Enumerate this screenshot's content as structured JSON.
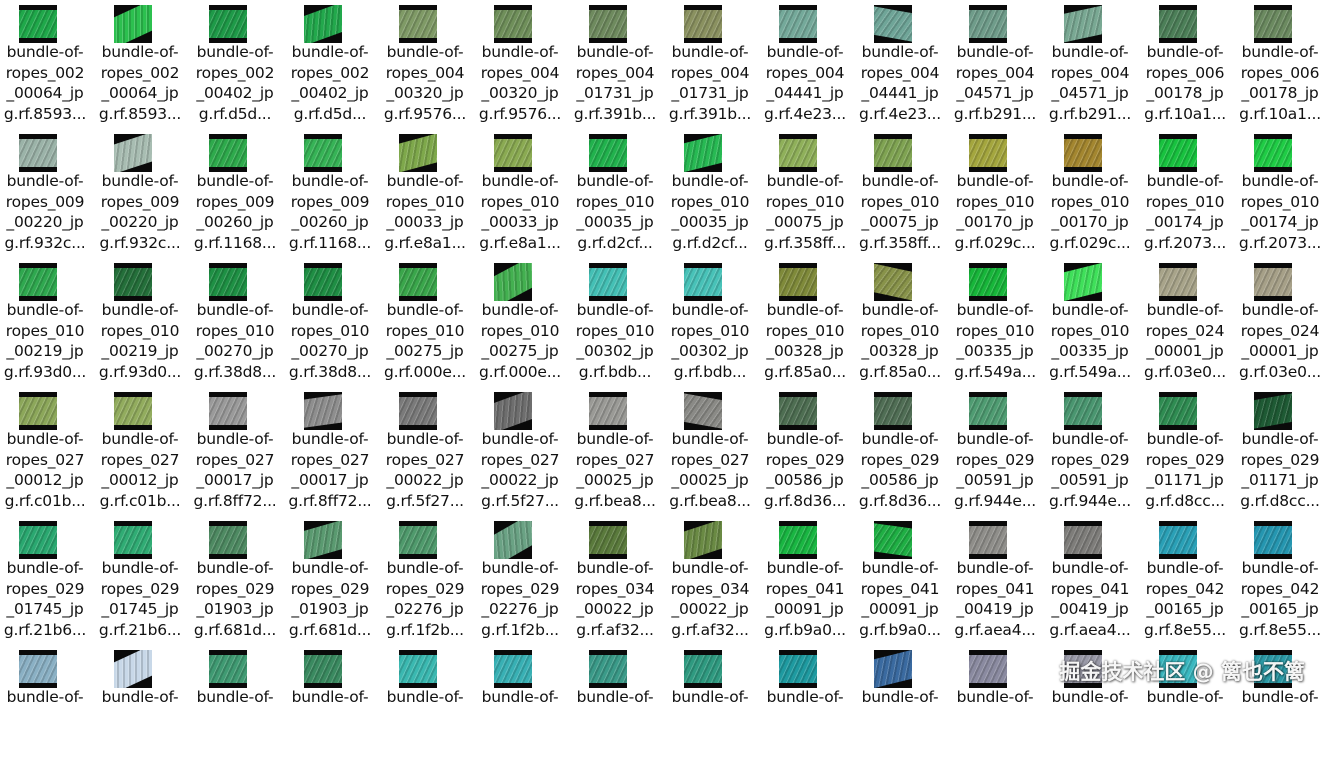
{
  "files": [
    {
      "line1": "bundle-of-",
      "line2": "ropes_002",
      "line3": "_00064_jp",
      "line4": "g.rf.8593...",
      "color": "#1fa84a",
      "tilt": 0
    },
    {
      "line1": "bundle-of-",
      "line2": "ropes_002",
      "line3": "_00064_jp",
      "line4": "g.rf.8593...",
      "color": "#2cc04f",
      "tilt": -25
    },
    {
      "line1": "bundle-of-",
      "line2": "ropes_002",
      "line3": "_00402_jp",
      "line4": "g.rf.d5d...",
      "color": "#1e9a48",
      "tilt": 0
    },
    {
      "line1": "bundle-of-",
      "line2": "ropes_002",
      "line3": "_00402_jp",
      "line4": "g.rf.d5d...",
      "color": "#22a84c",
      "tilt": -20
    },
    {
      "line1": "bundle-of-",
      "line2": "ropes_004",
      "line3": "_00320_jp",
      "line4": "g.rf.9576...",
      "color": "#7f9a66",
      "tilt": 0
    },
    {
      "line1": "bundle-of-",
      "line2": "ropes_004",
      "line3": "_00320_jp",
      "line4": "g.rf.9576...",
      "color": "#6f8f5a",
      "tilt": 0
    },
    {
      "line1": "bundle-of-",
      "line2": "ropes_004",
      "line3": "_01731_jp",
      "line4": "g.rf.391b...",
      "color": "#6e8a5e",
      "tilt": 0
    },
    {
      "line1": "bundle-of-",
      "line2": "ropes_004",
      "line3": "_01731_jp",
      "line4": "g.rf.391b...",
      "color": "#8a9160",
      "tilt": 0
    },
    {
      "line1": "bundle-of-",
      "line2": "ropes_004",
      "line3": "_04441_jp",
      "line4": "g.rf.4e23...",
      "color": "#74a99a",
      "tilt": 0
    },
    {
      "line1": "bundle-of-",
      "line2": "ropes_004",
      "line3": "_04441_jp",
      "line4": "g.rf.4e23...",
      "color": "#6fa598",
      "tilt": 10
    },
    {
      "line1": "bundle-of-",
      "line2": "ropes_004",
      "line3": "_04571_jp",
      "line4": "g.rf.b291...",
      "color": "#6f9c8a",
      "tilt": 0
    },
    {
      "line1": "bundle-of-",
      "line2": "ropes_004",
      "line3": "_04571_jp",
      "line4": "g.rf.b291...",
      "color": "#79a893",
      "tilt": -12
    },
    {
      "line1": "bundle-of-",
      "line2": "ropes_006",
      "line3": "_00178_jp",
      "line4": "g.rf.10a1...",
      "color": "#4c7f58",
      "tilt": 0
    },
    {
      "line1": "bundle-of-",
      "line2": "ropes_006",
      "line3": "_00178_jp",
      "line4": "g.rf.10a1...",
      "color": "#6b8a60",
      "tilt": 0
    },
    {
      "line1": "bundle-of-",
      "line2": "ropes_009",
      "line3": "_00220_jp",
      "line4": "g.rf.932c...",
      "color": "#9bb3a8",
      "tilt": 0
    },
    {
      "line1": "bundle-of-",
      "line2": "ropes_009",
      "line3": "_00220_jp",
      "line4": "g.rf.932c...",
      "color": "#a8bdb2",
      "tilt": -18
    },
    {
      "line1": "bundle-of-",
      "line2": "ropes_009",
      "line3": "_00260_jp",
      "line4": "g.rf.1168...",
      "color": "#2eaa4c",
      "tilt": 0
    },
    {
      "line1": "bundle-of-",
      "line2": "ropes_009",
      "line3": "_00260_jp",
      "line4": "g.rf.1168...",
      "color": "#36b356",
      "tilt": 0
    },
    {
      "line1": "bundle-of-",
      "line2": "ropes_010",
      "line3": "_00033_jp",
      "line4": "g.rf.e8a1...",
      "color": "#7ea84b",
      "tilt": -15
    },
    {
      "line1": "bundle-of-",
      "line2": "ropes_010",
      "line3": "_00033_jp",
      "line4": "g.rf.e8a1...",
      "color": "#8aaa52",
      "tilt": 0
    },
    {
      "line1": "bundle-of-",
      "line2": "ropes_010",
      "line3": "_00035_jp",
      "line4": "g.rf.d2cf...",
      "color": "#21b24d",
      "tilt": 0
    },
    {
      "line1": "bundle-of-",
      "line2": "ropes_010",
      "line3": "_00035_jp",
      "line4": "g.rf.d2cf...",
      "color": "#27b953",
      "tilt": -14
    },
    {
      "line1": "bundle-of-",
      "line2": "ropes_010",
      "line3": "_00075_jp",
      "line4": "g.rf.358ff...",
      "color": "#8fb05a",
      "tilt": 0
    },
    {
      "line1": "bundle-of-",
      "line2": "ropes_010",
      "line3": "_00075_jp",
      "line4": "g.rf.358ff...",
      "color": "#7fa352",
      "tilt": 0
    },
    {
      "line1": "bundle-of-",
      "line2": "ropes_010",
      "line3": "_00170_jp",
      "line4": "g.rf.029c...",
      "color": "#a4a63e",
      "tilt": 0
    },
    {
      "line1": "bundle-of-",
      "line2": "ropes_010",
      "line3": "_00170_jp",
      "line4": "g.rf.029c...",
      "color": "#a3862f",
      "tilt": 0
    },
    {
      "line1": "bundle-of-",
      "line2": "ropes_010",
      "line3": "_00174_jp",
      "line4": "g.rf.2073...",
      "color": "#18c23f",
      "tilt": 0
    },
    {
      "line1": "bundle-of-",
      "line2": "ropes_010",
      "line3": "_00174_jp",
      "line4": "g.rf.2073...",
      "color": "#1fcc45",
      "tilt": 0
    },
    {
      "line1": "bundle-of-",
      "line2": "ropes_010",
      "line3": "_00219_jp",
      "line4": "g.rf.93d0...",
      "color": "#2fa84f",
      "tilt": 0
    },
    {
      "line1": "bundle-of-",
      "line2": "ropes_010",
      "line3": "_00219_jp",
      "line4": "g.rf.93d0...",
      "color": "#246f3a",
      "tilt": 0
    },
    {
      "line1": "bundle-of-",
      "line2": "ropes_010",
      "line3": "_00270_jp",
      "line4": "g.rf.38d8...",
      "color": "#1e9044",
      "tilt": 0
    },
    {
      "line1": "bundle-of-",
      "line2": "ropes_010",
      "line3": "_00270_jp",
      "line4": "g.rf.38d8...",
      "color": "#1f8e44",
      "tilt": 0
    },
    {
      "line1": "bundle-of-",
      "line2": "ropes_010",
      "line3": "_00275_jp",
      "line4": "g.rf.000e...",
      "color": "#3aa64b",
      "tilt": 0
    },
    {
      "line1": "bundle-of-",
      "line2": "ropes_010",
      "line3": "_00275_jp",
      "line4": "g.rf.000e...",
      "color": "#43b050",
      "tilt": -28
    },
    {
      "line1": "bundle-of-",
      "line2": "ropes_010",
      "line3": "_00302_jp",
      "line4": "g.rf.bdb...",
      "color": "#44c0b5",
      "tilt": 0
    },
    {
      "line1": "bundle-of-",
      "line2": "ropes_010",
      "line3": "_00302_jp",
      "line4": "g.rf.bdb...",
      "color": "#48c2b8",
      "tilt": 0
    },
    {
      "line1": "bundle-of-",
      "line2": "ropes_010",
      "line3": "_00328_jp",
      "line4": "g.rf.85a0...",
      "color": "#7f8a3a",
      "tilt": 0
    },
    {
      "line1": "bundle-of-",
      "line2": "ropes_010",
      "line3": "_00328_jp",
      "line4": "g.rf.85a0...",
      "color": "#88934a",
      "tilt": 12
    },
    {
      "line1": "bundle-of-",
      "line2": "ropes_010",
      "line3": "_00335_jp",
      "line4": "g.rf.549a...",
      "color": "#17b63a",
      "tilt": 0
    },
    {
      "line1": "bundle-of-",
      "line2": "ropes_010",
      "line3": "_00335_jp",
      "line4": "g.rf.549a...",
      "color": "#3fe05a",
      "tilt": -14
    },
    {
      "line1": "bundle-of-",
      "line2": "ropes_024",
      "line3": "_00001_jp",
      "line4": "g.rf.03e0...",
      "color": "#a8a48a",
      "tilt": 0
    },
    {
      "line1": "bundle-of-",
      "line2": "ropes_024",
      "line3": "_00001_jp",
      "line4": "g.rf.03e0...",
      "color": "#a6a088",
      "tilt": 0
    },
    {
      "line1": "bundle-of-",
      "line2": "ropes_027",
      "line3": "_00012_jp",
      "line4": "g.rf.c01b...",
      "color": "#8ca75a",
      "tilt": 0
    },
    {
      "line1": "bundle-of-",
      "line2": "ropes_027",
      "line3": "_00012_jp",
      "line4": "g.rf.c01b...",
      "color": "#92ac5e",
      "tilt": 0
    },
    {
      "line1": "bundle-of-",
      "line2": "ropes_027",
      "line3": "_00017_jp",
      "line4": "g.rf.8ff72...",
      "color": "#9a9a9a",
      "tilt": 0
    },
    {
      "line1": "bundle-of-",
      "line2": "ropes_027",
      "line3": "_00017_jp",
      "line4": "g.rf.8ff72...",
      "color": "#8e8e8e",
      "tilt": -8
    },
    {
      "line1": "bundle-of-",
      "line2": "ropes_027",
      "line3": "_00022_jp",
      "line4": "g.rf.5f27...",
      "color": "#7a7a7a",
      "tilt": 0
    },
    {
      "line1": "bundle-of-",
      "line2": "ropes_027",
      "line3": "_00022_jp",
      "line4": "g.rf.5f27...",
      "color": "#6e6e6e",
      "tilt": -20
    },
    {
      "line1": "bundle-of-",
      "line2": "ropes_027",
      "line3": "_00025_jp",
      "line4": "g.rf.bea8...",
      "color": "#9a9a96",
      "tilt": 0
    },
    {
      "line1": "bundle-of-",
      "line2": "ropes_027",
      "line3": "_00025_jp",
      "line4": "g.rf.bea8...",
      "color": "#8a8a86",
      "tilt": 10
    },
    {
      "line1": "bundle-of-",
      "line2": "ropes_029",
      "line3": "_00586_jp",
      "line4": "g.rf.8d36...",
      "color": "#4e6e52",
      "tilt": 0
    },
    {
      "line1": "bundle-of-",
      "line2": "ropes_029",
      "line3": "_00586_jp",
      "line4": "g.rf.8d36...",
      "color": "#506e55",
      "tilt": 0
    },
    {
      "line1": "bundle-of-",
      "line2": "ropes_029",
      "line3": "_00591_jp",
      "line4": "g.rf.944e...",
      "color": "#4f9c72",
      "tilt": 0
    },
    {
      "line1": "bundle-of-",
      "line2": "ropes_029",
      "line3": "_00591_jp",
      "line4": "g.rf.944e...",
      "color": "#4a9670",
      "tilt": 0
    },
    {
      "line1": "bundle-of-",
      "line2": "ropes_029",
      "line3": "_01171_jp",
      "line4": "g.rf.d8cc...",
      "color": "#2f8c52",
      "tilt": 0
    },
    {
      "line1": "bundle-of-",
      "line2": "ropes_029",
      "line3": "_01171_jp",
      "line4": "g.rf.d8cc...",
      "color": "#1e5a34",
      "tilt": -10
    },
    {
      "line1": "bundle-of-",
      "line2": "ropes_029",
      "line3": "_01745_jp",
      "line4": "g.rf.21b6...",
      "color": "#2aa870",
      "tilt": 0
    },
    {
      "line1": "bundle-of-",
      "line2": "ropes_029",
      "line3": "_01745_jp",
      "line4": "g.rf.21b6...",
      "color": "#30ac74",
      "tilt": 0
    },
    {
      "line1": "bundle-of-",
      "line2": "ropes_029",
      "line3": "_01903_jp",
      "line4": "g.rf.681d...",
      "color": "#4e8a62",
      "tilt": 0
    },
    {
      "line1": "bundle-of-",
      "line2": "ropes_029",
      "line3": "_01903_jp",
      "line4": "g.rf.681d...",
      "color": "#5a9a70",
      "tilt": -16
    },
    {
      "line1": "bundle-of-",
      "line2": "ropes_029",
      "line3": "_02276_jp",
      "line4": "g.rf.1f2b...",
      "color": "#4f9a6c",
      "tilt": 0
    },
    {
      "line1": "bundle-of-",
      "line2": "ropes_029",
      "line3": "_02276_jp",
      "line4": "g.rf.1f2b...",
      "color": "#6aa284",
      "tilt": -30
    },
    {
      "line1": "bundle-of-",
      "line2": "ropes_034",
      "line3": "_00022_jp",
      "line4": "g.rf.af32...",
      "color": "#5a7a3c",
      "tilt": 0
    },
    {
      "line1": "bundle-of-",
      "line2": "ropes_034",
      "line3": "_00022_jp",
      "line4": "g.rf.af32...",
      "color": "#6a8a44",
      "tilt": -18
    },
    {
      "line1": "bundle-of-",
      "line2": "ropes_041",
      "line3": "_00091_jp",
      "line4": "g.rf.b9a0...",
      "color": "#19b642",
      "tilt": 0
    },
    {
      "line1": "bundle-of-",
      "line2": "ropes_041",
      "line3": "_00091_jp",
      "line4": "g.rf.b9a0...",
      "color": "#1faf44",
      "tilt": 8
    },
    {
      "line1": "bundle-of-",
      "line2": "ropes_041",
      "line3": "_00419_jp",
      "line4": "g.rf.aea4...",
      "color": "#8f8e8a",
      "tilt": 0
    },
    {
      "line1": "bundle-of-",
      "line2": "ropes_041",
      "line3": "_00419_jp",
      "line4": "g.rf.aea4...",
      "color": "#7e7d7a",
      "tilt": 0
    },
    {
      "line1": "bundle-of-",
      "line2": "ropes_042",
      "line3": "_00165_jp",
      "line4": "g.rf.8e55...",
      "color": "#2aa0b6",
      "tilt": 0
    },
    {
      "line1": "bundle-of-",
      "line2": "ropes_042",
      "line3": "_00165_jp",
      "line4": "g.rf.8e55...",
      "color": "#2596b0",
      "tilt": 0
    },
    {
      "line1": "bundle-of-",
      "line2": "",
      "line3": "",
      "line4": "",
      "color": "#8ab0c4",
      "tilt": 0
    },
    {
      "line1": "bundle-of-",
      "line2": "",
      "line3": "",
      "line4": "",
      "color": "#c8d8e8",
      "tilt": -25
    },
    {
      "line1": "bundle-of-",
      "line2": "",
      "line3": "",
      "line4": "",
      "color": "#3f9a72",
      "tilt": 0
    },
    {
      "line1": "bundle-of-",
      "line2": "",
      "line3": "",
      "line4": "",
      "color": "#3a8a60",
      "tilt": 0
    },
    {
      "line1": "bundle-of-",
      "line2": "",
      "line3": "",
      "line4": "",
      "color": "#3ab8b0",
      "tilt": 0
    },
    {
      "line1": "bundle-of-",
      "line2": "",
      "line3": "",
      "line4": "",
      "color": "#38b0b4",
      "tilt": 0
    },
    {
      "line1": "bundle-of-",
      "line2": "",
      "line3": "",
      "line4": "",
      "color": "#3a9a88",
      "tilt": 0
    },
    {
      "line1": "bundle-of-",
      "line2": "",
      "line3": "",
      "line4": "",
      "color": "#2f9a80",
      "tilt": 0
    },
    {
      "line1": "bundle-of-",
      "line2": "",
      "line3": "",
      "line4": "",
      "color": "#1e9aa0",
      "tilt": 0
    },
    {
      "line1": "bundle-of-",
      "line2": "",
      "line3": "",
      "line4": "",
      "color": "#3a6aa0",
      "tilt": -14
    },
    {
      "line1": "bundle-of-",
      "line2": "",
      "line3": "",
      "line4": "",
      "color": "#8a8aa0",
      "tilt": 0
    },
    {
      "line1": "bundle-of-",
      "line2": "",
      "line3": "",
      "line4": "",
      "color": "#9a9aa8",
      "tilt": 0
    },
    {
      "line1": "bundle-of-",
      "line2": "",
      "line3": "",
      "line4": "",
      "color": "#3ab8c0",
      "tilt": 0
    },
    {
      "line1": "bundle-of-",
      "line2": "",
      "line3": "",
      "line4": "",
      "color": "#2c9aa6",
      "tilt": 0
    }
  ],
  "watermark": "掘金技术社区 @ 篱也不篱"
}
